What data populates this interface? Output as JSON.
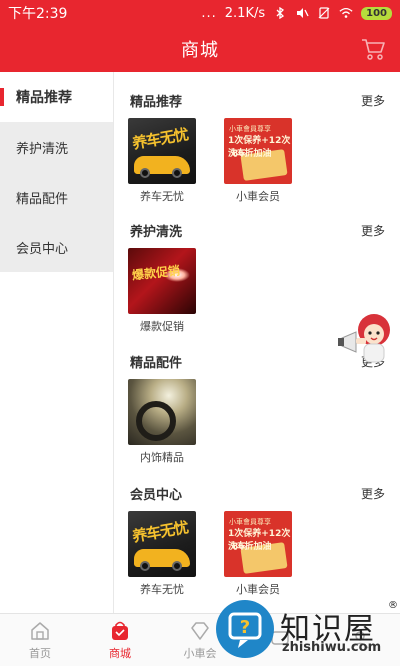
{
  "status_bar": {
    "time": "下午2:39",
    "dots": "...",
    "speed": "2.1K/s",
    "battery": "100"
  },
  "header": {
    "title": "商城",
    "cart_icon": "cart-icon"
  },
  "sidebar": {
    "items": [
      {
        "label": "精品推荐",
        "active": true
      },
      {
        "label": "养护清洗",
        "active": false
      },
      {
        "label": "精品配件",
        "active": false
      },
      {
        "label": "会员中心",
        "active": false
      }
    ]
  },
  "sections": [
    {
      "title": "精品推荐",
      "more": "更多",
      "tiles": [
        {
          "label": "养车无忧",
          "thumb_text": "养车无忧"
        },
        {
          "label": "小車会员",
          "thumb_text": ""
        }
      ]
    },
    {
      "title": "养护清洗",
      "more": "更多",
      "tiles": [
        {
          "label": "爆款促销",
          "thumb_text": "爆款促销"
        }
      ]
    },
    {
      "title": "精品配件",
      "more": "更多",
      "tiles": [
        {
          "label": "内饰精品",
          "thumb_text": ""
        }
      ]
    },
    {
      "title": "会员中心",
      "more": "更多",
      "tiles": [
        {
          "label": "养车无忧",
          "thumb_text": "养车无忧"
        },
        {
          "label": "小車会员",
          "thumb_text": ""
        }
      ]
    }
  ],
  "member_thumb": {
    "line1": "小車會員尊享",
    "line2": "1次保养+12次洗车",
    "line3": "86折加油"
  },
  "bottom_nav": {
    "items": [
      {
        "label": "首页",
        "active": false
      },
      {
        "label": "商城",
        "active": true
      },
      {
        "label": "小車会",
        "active": false
      },
      {
        "label": "",
        "active": false
      },
      {
        "label": "",
        "active": false
      }
    ]
  },
  "watermark": {
    "brand": "知识屋",
    "sub": "zhishiwu.com",
    "reg": "®"
  },
  "colors": {
    "brand_red": "#e8262f",
    "sidebar_bg": "#ececec"
  }
}
